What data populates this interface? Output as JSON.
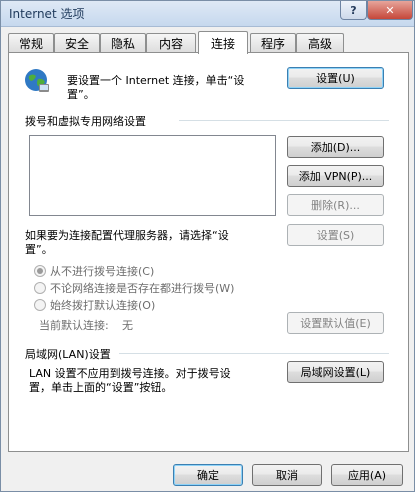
{
  "window": {
    "title": "Internet 选项",
    "help_label": "?",
    "close_label": "✕"
  },
  "tabs": [
    {
      "label": "常规"
    },
    {
      "label": "安全"
    },
    {
      "label": "隐私"
    },
    {
      "label": "内容"
    },
    {
      "label": "连接",
      "active": true
    },
    {
      "label": "程序"
    },
    {
      "label": "高级"
    }
  ],
  "setup": {
    "text_line1": "要设置一个 Internet 连接，单击“设",
    "text_line2": "置”。",
    "button": "设置(U)",
    "icon": "globe-network-icon"
  },
  "dialup": {
    "heading": "拨号和虚拟专用网络设置",
    "add_button": "添加(D)...",
    "add_vpn_button": "添加 VPN(P)...",
    "remove_button": "删除(R)...",
    "proxy_text_line1": "如果要为连接配置代理服务器，请选择“设",
    "proxy_text_line2": "置”。",
    "settings_button": "设置(S)",
    "options": [
      {
        "label": "从不进行拨号连接(C)",
        "selected": true
      },
      {
        "label": "不论网络连接是否存在都进行拨号(W)",
        "selected": false
      },
      {
        "label": "始终拨打默认连接(O)",
        "selected": false
      }
    ],
    "current_default_label": "当前默认连接:",
    "current_default_value": "无",
    "set_default_button": "设置默认值(E)"
  },
  "lan": {
    "heading": "局域网(LAN)设置",
    "text_line1": "LAN 设置不应用到拨号连接。对于拨号设",
    "text_line2": "置，单击上面的“设置”按钮。",
    "button": "局域网设置(L)"
  },
  "footer": {
    "ok": "确定",
    "cancel": "取消",
    "apply": "应用(A)"
  },
  "colors": {
    "accent": "#3c7fb1",
    "section_heading": "#000000"
  }
}
